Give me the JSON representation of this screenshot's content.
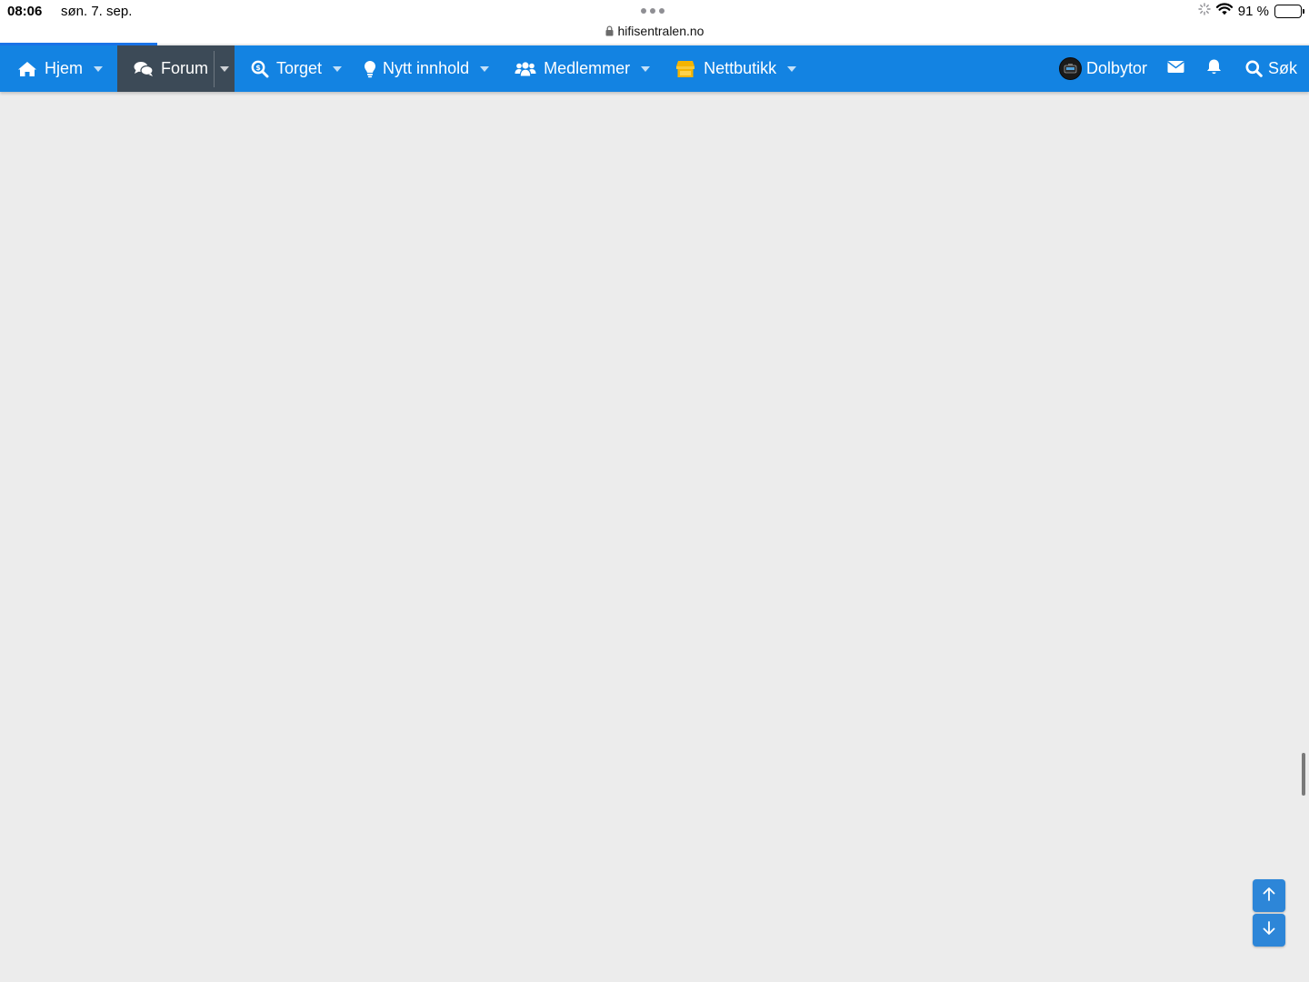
{
  "status_bar": {
    "time": "08:06",
    "date": "søn. 7. sep.",
    "battery": "91 %",
    "battery_level": 0.91,
    "url": "hifisentralen.no"
  },
  "navbar": {
    "accent_color": "#1383e2",
    "active_color": "#3c4a57",
    "items": [
      {
        "label": "Hjem",
        "icon": "home-icon"
      },
      {
        "label": "Forum",
        "icon": "comments-icon"
      },
      {
        "label": "Torget",
        "icon": "search-dollar-icon"
      },
      {
        "label": "Nytt innhold",
        "icon": "lightbulb-icon"
      },
      {
        "label": "Medlemmer",
        "icon": "users-icon"
      },
      {
        "label": "Nettbutikk",
        "icon": "store-icon"
      }
    ],
    "user": {
      "name": "Dolbytor"
    },
    "search_label": "Søk"
  }
}
